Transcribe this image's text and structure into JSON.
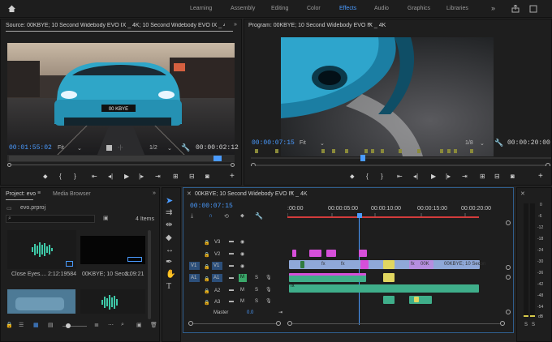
{
  "workspaces": [
    "Learning",
    "Assembly",
    "Editing",
    "Color",
    "Effects",
    "Audio",
    "Graphics",
    "Libraries"
  ],
  "active_workspace": "Effects",
  "source": {
    "title": "Source: 00KBYE; 10 Second Widebody EVO IX _ 4K; 10 Second Widebody EVO IX _ 4K.we",
    "timecode": "00:01:55:02",
    "fit": "Fit",
    "resolution": "1/2",
    "duration": "00:00:02:12",
    "plate": "00 KBYE"
  },
  "program": {
    "title": "Program: 00KBYE; 10 Second Widebody EVO IX _ 4K",
    "timecode": "00:00:07:15",
    "fit": "Fit",
    "resolution": "1/8",
    "duration": "00:00:20:00"
  },
  "project": {
    "tab1": "Project: evo",
    "tab2": "Media Browser",
    "file": "evo.prproj",
    "items": "4 Items",
    "bins": [
      {
        "name": "Close Eyes....",
        "duration": "2:12:19584"
      },
      {
        "name": "00KBYE; 10 Seco...",
        "duration": "3:09:21"
      }
    ]
  },
  "timeline": {
    "title": "00KBYE; 10 Second Widebody EVO IX _ 4K",
    "timecode": "00:00:07:15",
    "ruler": [
      ":00:00",
      "00:00:05:00",
      "00:00:10:00",
      "00:00:15:00",
      "00:00:20:00"
    ],
    "video_tracks": [
      "V3",
      "V2",
      "V1"
    ],
    "audio_tracks": [
      "A1",
      "A2",
      "A3"
    ],
    "master_label": "Master",
    "master_value": "0.0",
    "source_v1": "V1",
    "source_a1": "A1",
    "clip_label": "00KBYE; 10 Secon",
    "clip_label_short": "00K",
    "fx": "fx"
  },
  "meter": {
    "scale": [
      "0",
      "-6",
      "-12",
      "-18",
      "-24",
      "-30",
      "-36",
      "-42",
      "-48",
      "-54",
      "dB"
    ],
    "solo": "S"
  }
}
